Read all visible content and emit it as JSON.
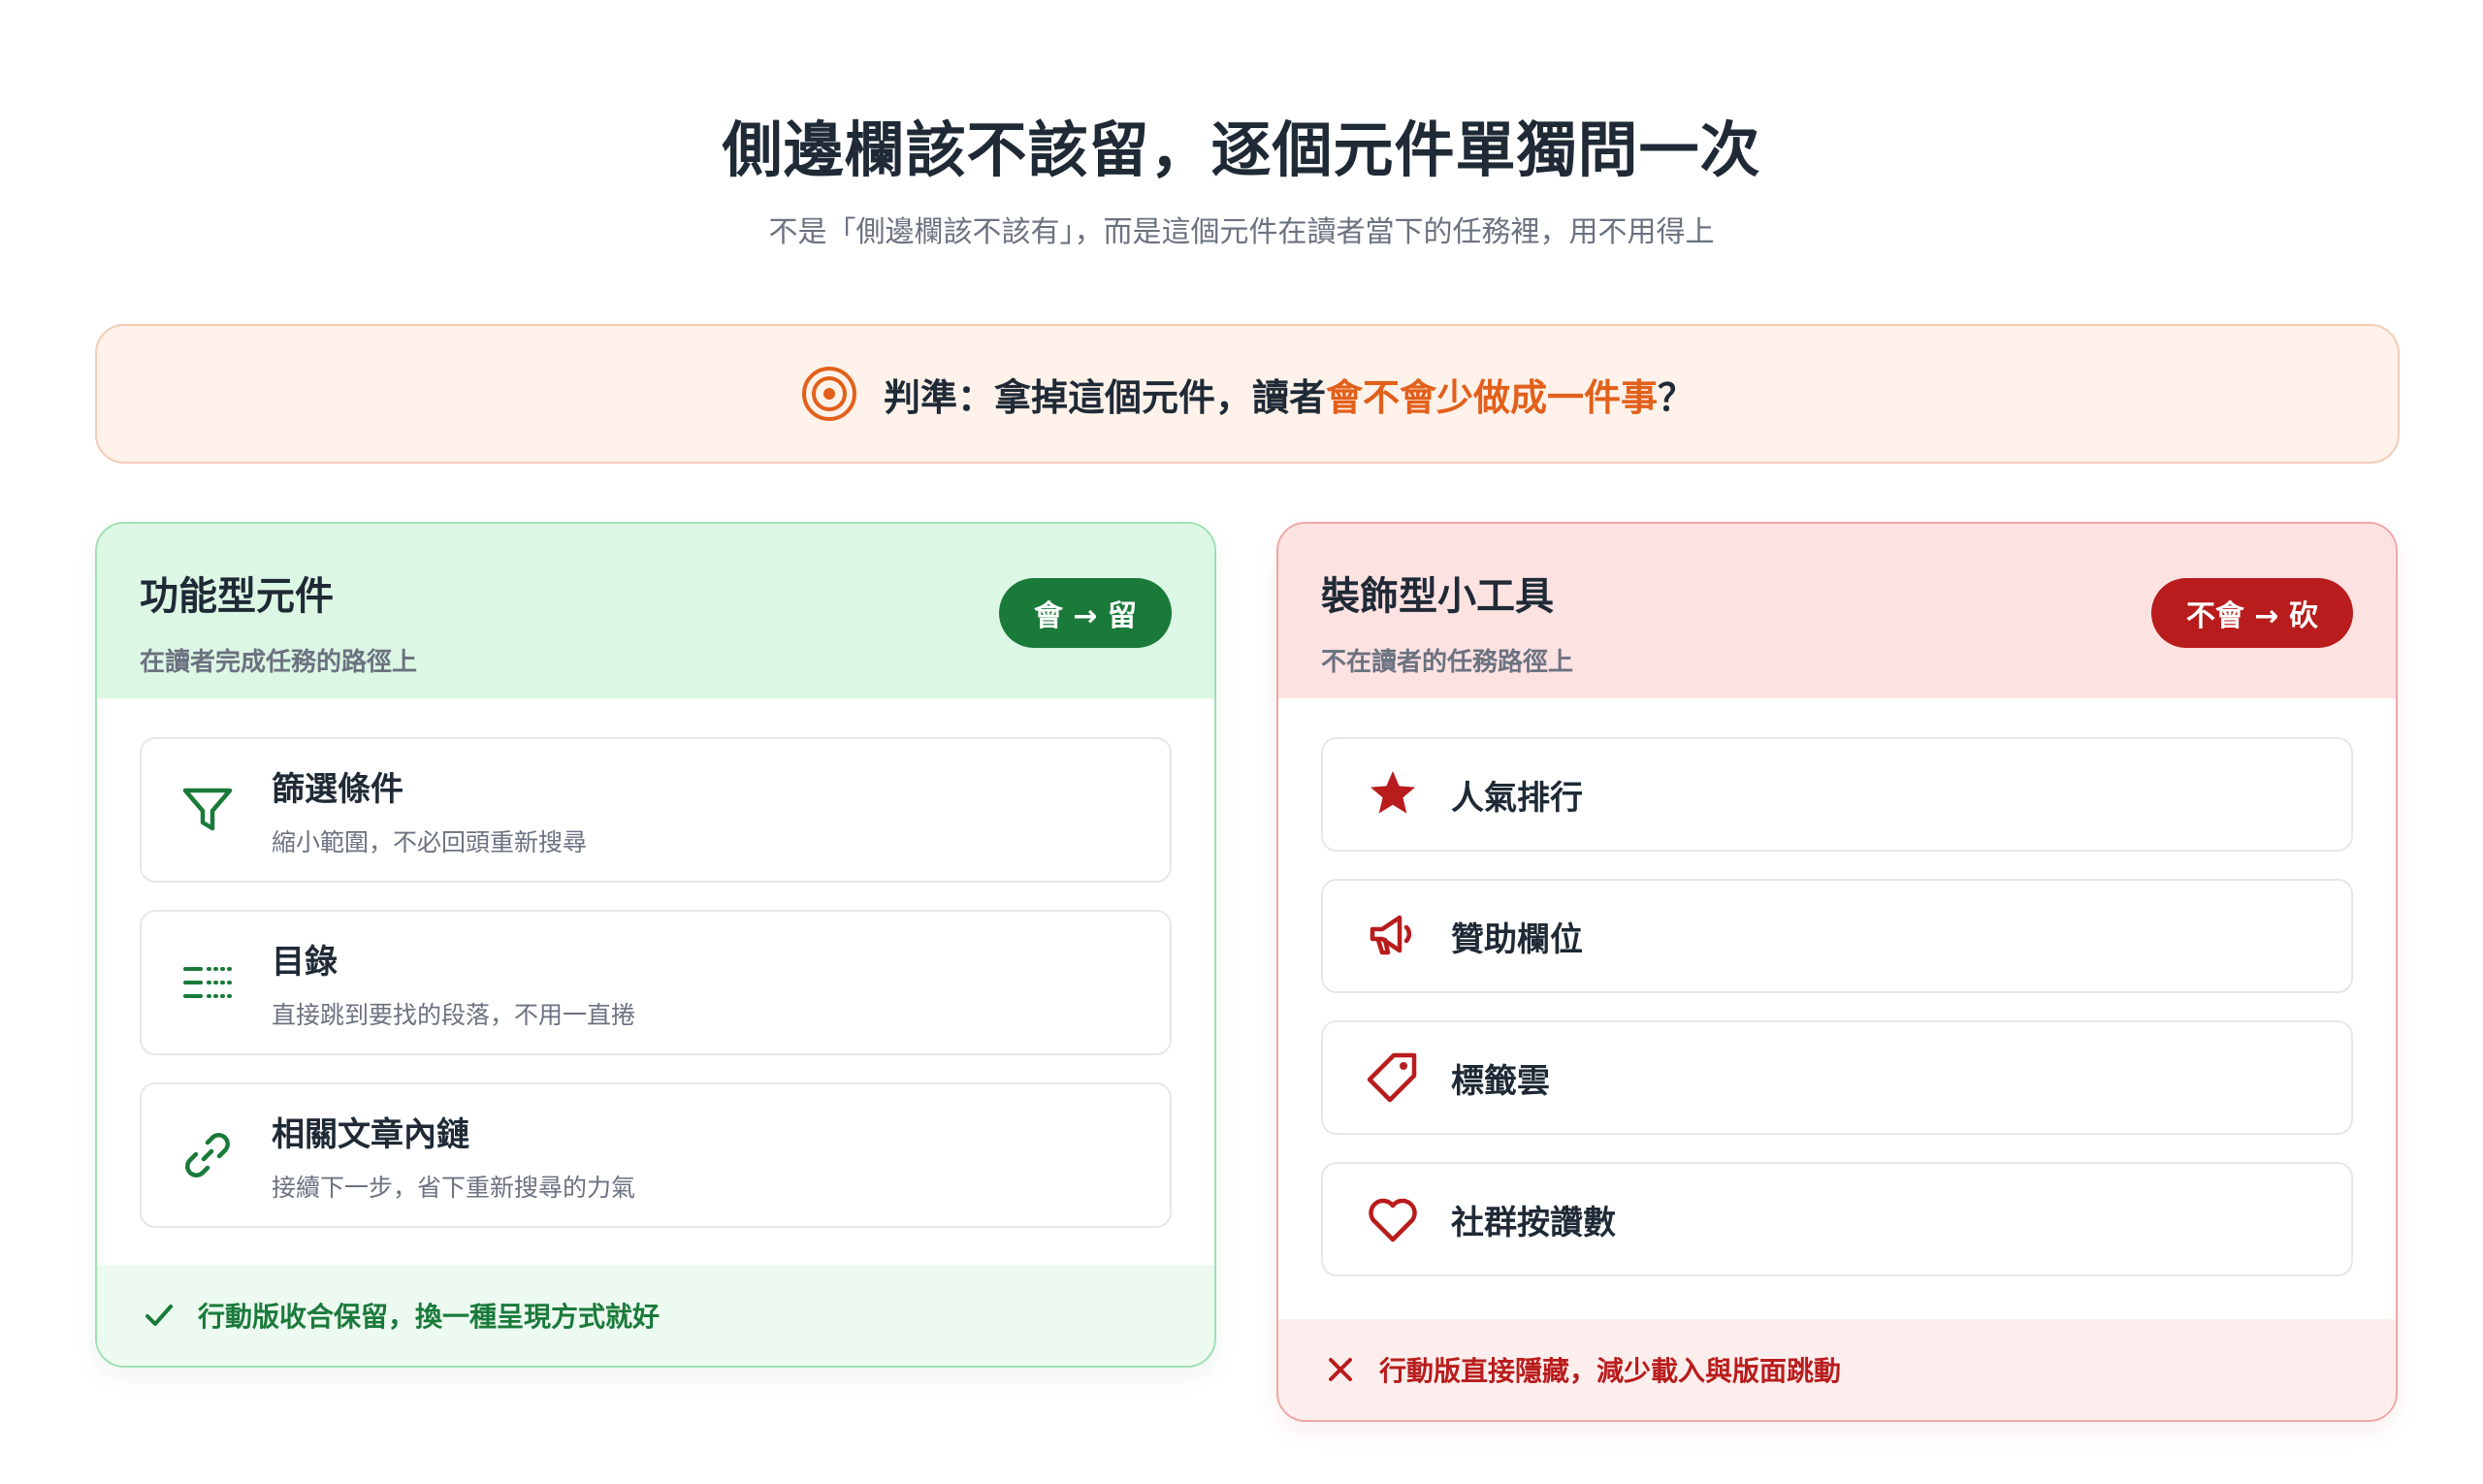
{
  "header": {
    "title": "側邊欄該不該留，逐個元件單獨問一次",
    "subtitle": "不是「側邊欄該不該有」，而是這個元件在讀者當下的任務裡，用不用得上"
  },
  "criterion": {
    "icon": "target-icon",
    "prefix": "判準：拿掉這個元件，讀者",
    "highlight": "會不會少做成一件事",
    "suffix": "？",
    "accent_color": "#e2601b"
  },
  "keep_panel": {
    "title": "功能型元件",
    "description": "在讀者完成任務的路徑上",
    "verdict": "會 → 留",
    "color": "#1a7a3a",
    "items": [
      {
        "icon": "filter-icon",
        "name": "篩選條件",
        "description": "縮小範圍，不必回頭重新搜尋"
      },
      {
        "icon": "toc-list-icon",
        "name": "目錄",
        "description": "直接跳到要找的段落，不用一直捲"
      },
      {
        "icon": "link-icon",
        "name": "相關文章內鏈",
        "description": "接續下一步，省下重新搜尋的力氣"
      }
    ],
    "footer": {
      "icon": "check-icon",
      "text": "行動版收合保留，換一種呈現方式就好"
    }
  },
  "cut_panel": {
    "title": "裝飾型小工具",
    "description": "不在讀者的任務路徑上",
    "verdict": "不會 → 砍",
    "color": "#b91c1c",
    "items": [
      {
        "icon": "star-icon",
        "name": "人氣排行"
      },
      {
        "icon": "megaphone-icon",
        "name": "贊助欄位"
      },
      {
        "icon": "tag-icon",
        "name": "標籤雲"
      },
      {
        "icon": "heart-icon",
        "name": "社群按讚數"
      }
    ],
    "footer": {
      "icon": "x-icon",
      "text": "行動版直接隱藏，減少載入與版面跳動"
    }
  }
}
